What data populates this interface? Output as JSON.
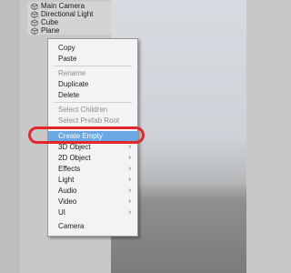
{
  "hierarchy": {
    "items": [
      {
        "label": "Main Camera",
        "icon": "cube-icon"
      },
      {
        "label": "Directional Light",
        "icon": "cube-icon"
      },
      {
        "label": "Cube",
        "icon": "cube-icon"
      },
      {
        "label": "Plane",
        "icon": "cube-icon"
      }
    ]
  },
  "context_menu": {
    "copy": "Copy",
    "paste": "Paste",
    "rename": "Rename",
    "duplicate": "Duplicate",
    "delete": "Delete",
    "select_children": "Select Children",
    "select_prefab_root": "Select Prefab Root",
    "create_empty": "Create Empty",
    "obj_3d": "3D Object",
    "obj_2d": "2D Object",
    "effects": "Effects",
    "light": "Light",
    "audio": "Audio",
    "video": "Video",
    "ui": "UI",
    "camera": "Camera",
    "submenu_arrow": "›"
  },
  "colors": {
    "highlight": "#6aa8e4",
    "annotation": "#e2262a"
  }
}
